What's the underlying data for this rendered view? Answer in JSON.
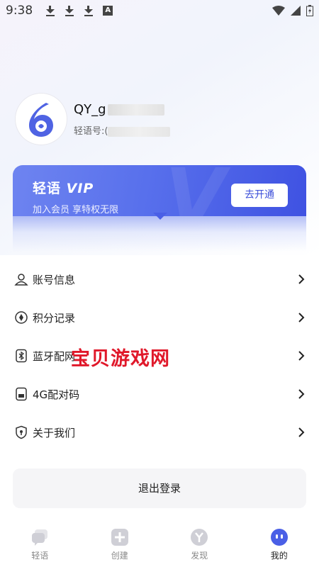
{
  "status_bar": {
    "time": "9:38"
  },
  "profile": {
    "name_prefix": "QY_g",
    "id_prefix": "轻语号:("
  },
  "vip": {
    "title_cn": "轻语",
    "title_vip": "VIP",
    "subtitle": "加入会员 享特权无限",
    "button": "去开通"
  },
  "menu": [
    {
      "label": "账号信息",
      "icon": "user-icon"
    },
    {
      "label": "积分记录",
      "icon": "points-icon"
    },
    {
      "label": "蓝牙配网",
      "icon": "bluetooth-icon"
    },
    {
      "label": "4G配对码",
      "icon": "sim-card-icon"
    },
    {
      "label": "关于我们",
      "icon": "shield-icon"
    }
  ],
  "watermark": "宝贝游戏网",
  "logout_label": "退出登录",
  "tabs": [
    {
      "label": "轻语",
      "icon": "chat-icon"
    },
    {
      "label": "创建",
      "icon": "plus-icon"
    },
    {
      "label": "发现",
      "icon": "discover-icon"
    },
    {
      "label": "我的",
      "icon": "profile-icon",
      "active": true
    }
  ],
  "colors": {
    "accent": "#4a5fe6",
    "watermark": "#e0182a"
  }
}
